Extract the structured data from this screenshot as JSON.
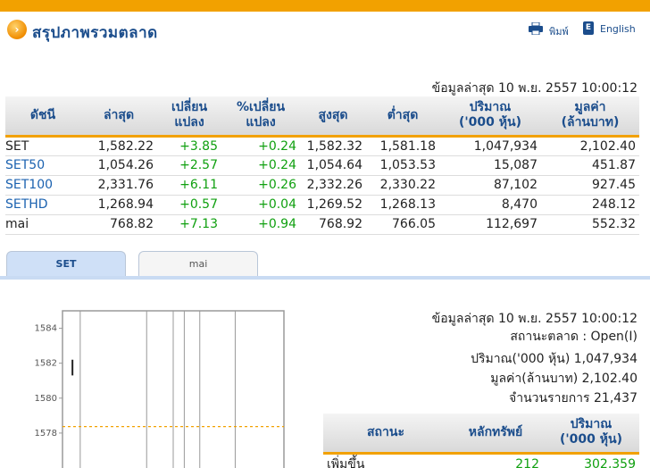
{
  "header": {
    "title": "สรุปภาพรวมตลาด",
    "print_label": "พิมพ์",
    "lang_label": "English",
    "icons": [
      "arrow-right-icon",
      "printer-icon",
      "book-icon"
    ]
  },
  "updated_text": "ข้อมูลล่าสุด 10 พ.ย. 2557 10:00:12",
  "index_table": {
    "headers": [
      "ดัชนี",
      "ล่าสุด",
      "เปลี่ยน\nแปลง",
      "%เปลี่ยน\nแปลง",
      "สูงสุด",
      "ต่ำสุด",
      "ปริมาณ\n('000 หุ้น)",
      "มูลค่า\n(ล้านบาท)"
    ],
    "rows": [
      {
        "name": "SET",
        "last": "1,582.22",
        "change": "+3.85",
        "pct": "+0.24",
        "high": "1,582.32",
        "low": "1,581.18",
        "volume": "1,047,934",
        "value": "2,102.40"
      },
      {
        "name": "SET50",
        "last": "1,054.26",
        "change": "+2.57",
        "pct": "+0.24",
        "high": "1,054.64",
        "low": "1,053.53",
        "volume": "15,087",
        "value": "451.87"
      },
      {
        "name": "SET100",
        "last": "2,331.76",
        "change": "+6.11",
        "pct": "+0.26",
        "high": "2,332.26",
        "low": "2,330.22",
        "volume": "87,102",
        "value": "927.45"
      },
      {
        "name": "SETHD",
        "last": "1,268.94",
        "change": "+0.57",
        "pct": "+0.04",
        "high": "1,269.52",
        "low": "1,268.13",
        "volume": "8,470",
        "value": "248.12"
      },
      {
        "name": "mai",
        "last": "768.82",
        "change": "+7.13",
        "pct": "+0.94",
        "high": "768.92",
        "low": "766.05",
        "volume": "112,697",
        "value": "552.32"
      }
    ]
  },
  "tabs": [
    {
      "label": "SET",
      "active": true
    },
    {
      "label": "mai",
      "active": false
    }
  ],
  "market_info": {
    "updated": "ข้อมูลล่าสุด 10 พ.ย. 2557 10:00:12",
    "status": "สถานะตลาด : Open(I)",
    "volume": "ปริมาณ('000 หุ้น) 1,047,934",
    "value": "มูลค่า(ล้านบาท) 2,102.40",
    "transactions": "จำนวนรายการ 21,437"
  },
  "status_table": {
    "headers": [
      "สถานะ",
      "หลักทรัพย์",
      "ปริมาณ\n('000 หุ้น)"
    ],
    "rows": [
      {
        "status": "เพิ่มขึ้น",
        "count": "212",
        "volume": "302,359"
      }
    ]
  },
  "chart_data": {
    "type": "line",
    "yticks": [
      1584,
      1582,
      1580,
      1578
    ],
    "ylim": [
      1576,
      1585
    ],
    "reference_line": 1578.37,
    "series": [
      {
        "points": [
          [
            0.045,
            1582.2
          ],
          [
            0.045,
            1581.3
          ]
        ]
      }
    ],
    "colors": {
      "grid": "#9a9a9a",
      "reference": "#f2a100",
      "line": "#222222"
    }
  },
  "colors": {
    "accent": "#f2a100",
    "brand": "#1b4d8c",
    "up": "#10a010",
    "link": "#1b62b0"
  }
}
